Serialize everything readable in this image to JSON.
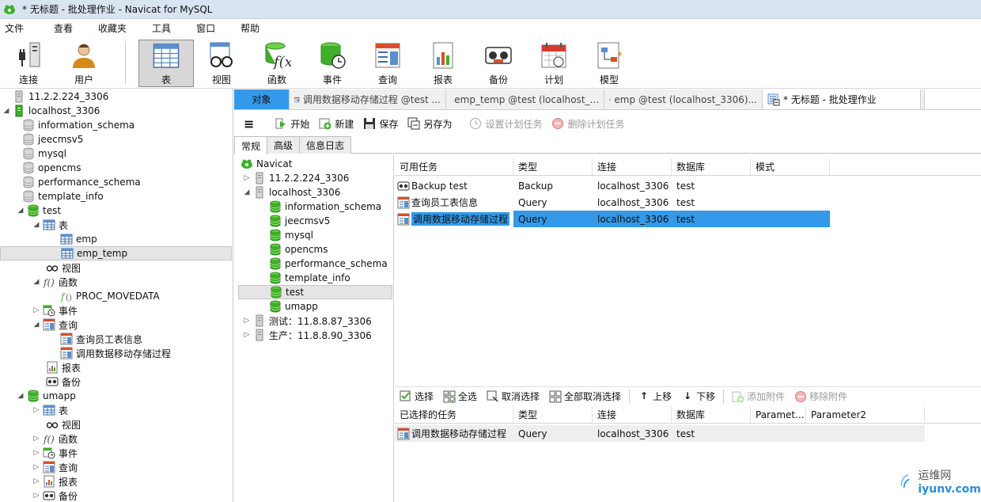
{
  "window": {
    "title": "* 无标题 - 批处理作业 - Navicat for MySQL"
  },
  "menu": [
    "文件",
    "查看",
    "收藏夹",
    "工具",
    "窗口",
    "帮助"
  ],
  "toolbar": {
    "connect": "连接",
    "user": "用户",
    "table": "表",
    "view": "视图",
    "function": "函数",
    "event": "事件",
    "query": "查询",
    "report": "报表",
    "backup": "备份",
    "schedule": "计划",
    "model": "模型"
  },
  "left_tree": {
    "conn1": "11.2.2.224_3306",
    "conn2": "localhost_3306",
    "db1": "information_schema",
    "db2": "jeecmsv5",
    "db3": "mysql",
    "db4": "opencms",
    "db5": "performance_schema",
    "db6": "template_info",
    "db7": "test",
    "test_tables": "表",
    "t1": "emp",
    "t2": "emp_temp",
    "test_views": "视图",
    "test_funcs": "函数",
    "f1": "PROC_MOVEDATA",
    "test_events": "事件",
    "test_queries": "查询",
    "q1": "查询员工表信息",
    "q2": "调用数据移动存储过程",
    "test_reports": "报表",
    "test_backups": "备份",
    "db8": "umapp",
    "u_tables": "表",
    "u_views": "视图",
    "u_funcs": "函数",
    "u_events": "事件",
    "u_queries": "查询",
    "u_reports": "报表",
    "u_backups": "备份"
  },
  "tabs": {
    "objects": "对象",
    "t1": "调用数据移动存储过程 @test ...",
    "t2": "emp_temp @test (localhost_...",
    "t3": "emp @test (localhost_3306)...",
    "t4": "* 无标题 - 批处理作业"
  },
  "subtoolbar": {
    "menu": "≡",
    "start": "开始",
    "new": "新建",
    "save": "保存",
    "save_as": "另存为",
    "set_schedule": "设置计划任务",
    "delete_schedule": "删除计划任务"
  },
  "subtabs": {
    "general": "常规",
    "advanced": "高级",
    "log": "信息日志"
  },
  "mid_tree": {
    "root": "Navicat",
    "c1": "11.2.2.224_3306",
    "c2": "localhost_3306",
    "d1": "information_schema",
    "d2": "jeecmsv5",
    "d3": "mysql",
    "d4": "opencms",
    "d5": "performance_schema",
    "d6": "template_info",
    "d7": "test",
    "d8": "umapp",
    "c3": "测试：11.8.8.87_3306",
    "c4": "生产：11.8.8.90_3306"
  },
  "available": {
    "headers": [
      "可用任务",
      "类型",
      "连接",
      "数据库",
      "模式"
    ],
    "rows": [
      [
        "Backup test",
        "Backup",
        "localhost_3306",
        "test"
      ],
      [
        "查询员工表信息",
        "Query",
        "localhost_3306",
        "test"
      ],
      [
        "调用数据移动存储过程",
        "Query",
        "localhost_3306",
        "test"
      ]
    ]
  },
  "lower_toolbar": {
    "select": "选择",
    "select_all": "全选",
    "deselect": "取消选择",
    "deselect_all": "全部取消选择",
    "up": "上移",
    "down": "下移",
    "add_attach": "添加附件",
    "remove_attach": "移除附件"
  },
  "selected": {
    "headers": [
      "已选择的任务",
      "类型",
      "连接",
      "数据库",
      "Paramet...",
      "Parameter2"
    ],
    "rows": [
      [
        "调用数据移动存储过程",
        "Query",
        "localhost_3306",
        "test"
      ]
    ]
  },
  "watermark": {
    "cn": "运维网",
    "en": "iyunv.com"
  },
  "colors": {
    "accent": "#3399e8",
    "db_green": "#3fae2a"
  }
}
